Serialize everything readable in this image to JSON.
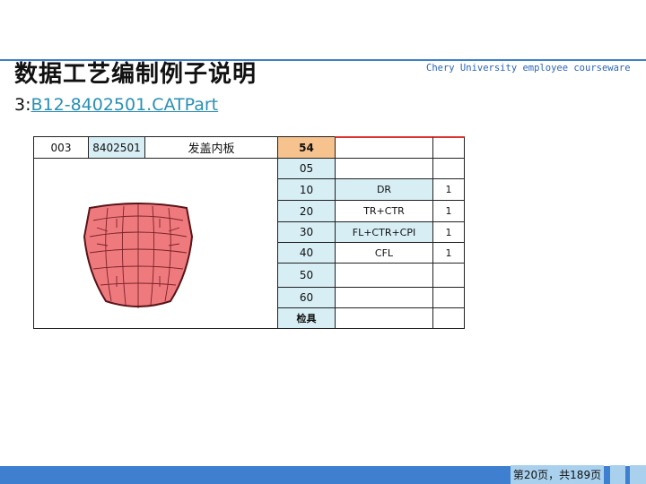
{
  "header": {
    "title": "数据工艺编制例子说明",
    "brand": "Chery University employee courseware",
    "subtitle_prefix": "3:",
    "subtitle_link": "B12-8402501.CATPart"
  },
  "sheet": {
    "header_cells": {
      "code": "003",
      "part_no": "8402501",
      "part_name": "发盖内板",
      "top_op": "54"
    },
    "rows": [
      {
        "op": "05",
        "process": "",
        "qty": ""
      },
      {
        "op": "10",
        "process": "DR",
        "qty": "1"
      },
      {
        "op": "20",
        "process": "TR+CTR",
        "qty": "1"
      },
      {
        "op": "30",
        "process": "FL+CTR+CPI",
        "qty": "1"
      },
      {
        "op": "40",
        "process": "CFL",
        "qty": "1"
      },
      {
        "op": "50",
        "process": "",
        "qty": ""
      },
      {
        "op": "60",
        "process": "",
        "qty": ""
      },
      {
        "op": "检具",
        "process": "",
        "qty": ""
      }
    ],
    "colors": {
      "op_cell": "#d6eef4",
      "highlight_op": "#f6c28e",
      "hood_fill": "#ef7a7e"
    }
  },
  "footer": {
    "page_text": "第20页，共189页"
  }
}
